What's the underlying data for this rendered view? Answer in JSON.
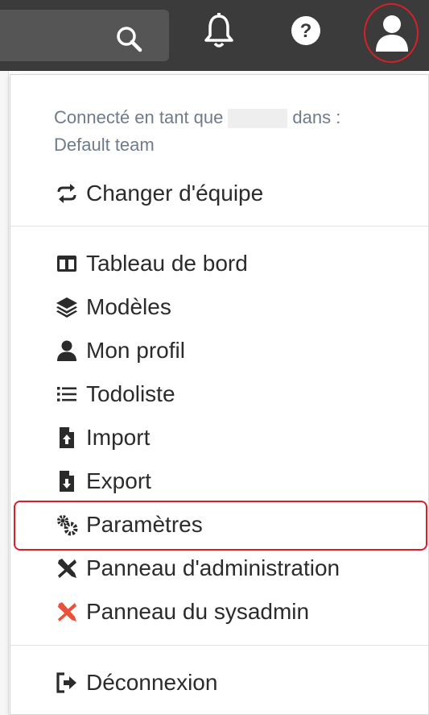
{
  "topbar": {
    "search_icon": "search-icon",
    "notifications_icon": "bell-icon",
    "help_icon": "question-circle-icon",
    "user_icon": "user-icon",
    "highlight_color": "#d8202a"
  },
  "dropdown": {
    "connected_prefix": "Connecté en tant que",
    "connected_suffix": "dans :",
    "team": "Default team",
    "switch_team": "Changer d'équipe",
    "items": [
      {
        "label": "Tableau de bord",
        "icon": "columns-icon"
      },
      {
        "label": "Modèles",
        "icon": "layers-icon"
      },
      {
        "label": "Mon profil",
        "icon": "user-icon"
      },
      {
        "label": "Todoliste",
        "icon": "list-icon"
      },
      {
        "label": "Import",
        "icon": "file-import-icon"
      },
      {
        "label": "Export",
        "icon": "file-export-icon"
      },
      {
        "label": "Paramètres",
        "icon": "cogs-icon"
      },
      {
        "label": "Panneau d'administration",
        "icon": "tools-icon"
      },
      {
        "label": "Panneau du sysadmin",
        "icon": "tools-red-icon"
      }
    ],
    "logout": "Déconnexion",
    "sysadmin_icon_color": "#e8513a"
  }
}
